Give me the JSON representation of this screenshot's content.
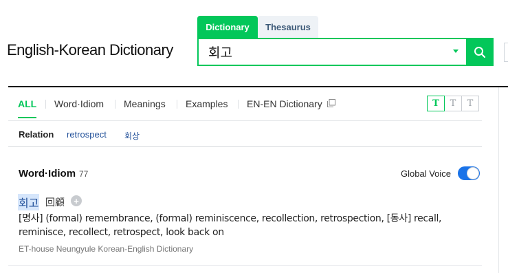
{
  "site": {
    "title": "English-Korean Dictionary"
  },
  "search": {
    "tabs": [
      {
        "label": "Dictionary",
        "active": true
      },
      {
        "label": "Thesaurus",
        "active": false
      }
    ],
    "query": "회고",
    "button_icon": "search-icon"
  },
  "nav": {
    "tabs": [
      {
        "label": "ALL",
        "active": true
      },
      {
        "label": "Word·Idiom"
      },
      {
        "label": "Meanings"
      },
      {
        "label": "Examples"
      },
      {
        "label": "EN-EN Dictionary",
        "icon": "copy-icon"
      }
    ],
    "font_sizes": [
      "T",
      "T",
      "T"
    ]
  },
  "relation": {
    "label": "Relation",
    "links": [
      "retrospect",
      "회상"
    ]
  },
  "section": {
    "title": "Word·Idiom",
    "count": "77",
    "global_voice_label": "Global Voice",
    "global_voice_on": true
  },
  "entry": {
    "word": "회고",
    "hanja": "回顧",
    "definition": "[명사] (formal) remembrance, (formal) reminiscence, recollection, retrospection, [동사] recall, reminisce, recollect, retrospect, look back on",
    "source": "ET-house Neungyule Korean-English Dictionary"
  },
  "colors": {
    "accent": "#03c75a",
    "link": "#1f4e98",
    "toggle": "#1a73e8"
  }
}
